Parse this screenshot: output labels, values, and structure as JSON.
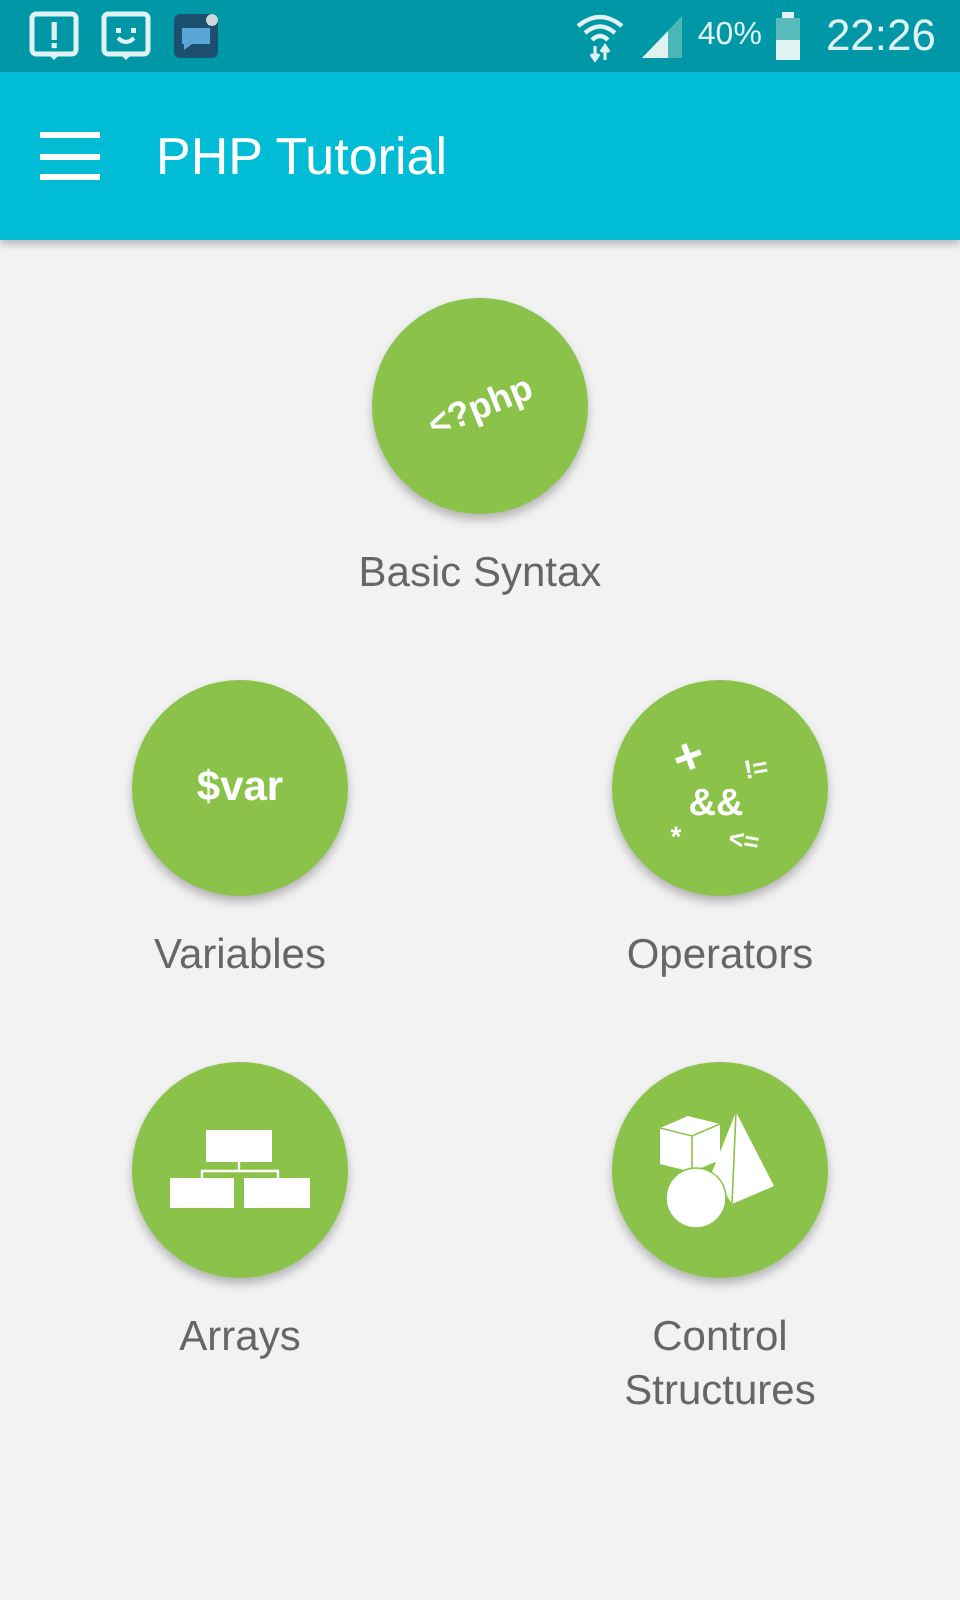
{
  "status_bar": {
    "battery": "40%",
    "time": "22:26"
  },
  "app_bar": {
    "title": "PHP Tutorial"
  },
  "topics": [
    {
      "kind": "syntax",
      "label": "Basic Syntax",
      "icon_text": [
        "<?php"
      ]
    },
    {
      "kind": "variables",
      "label": "Variables",
      "icon_text": [
        "$var"
      ]
    },
    {
      "kind": "operators",
      "label": "Operators",
      "icon_text": [
        "+",
        "!=",
        "&&",
        "*",
        "<="
      ]
    },
    {
      "kind": "arrays",
      "label": "Arrays"
    },
    {
      "kind": "control",
      "label": "Control Structures"
    }
  ]
}
